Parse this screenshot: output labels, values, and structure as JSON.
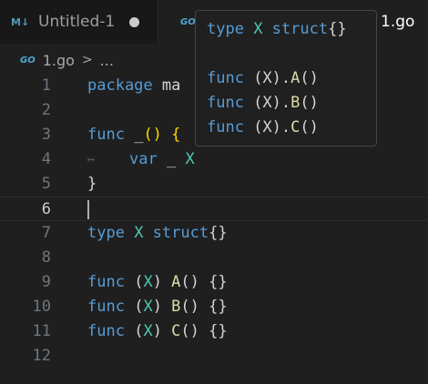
{
  "tabs": [
    {
      "label": "Untitled-1",
      "icon": "markdown-icon",
      "icon_text": "M↓",
      "dirty": true
    },
    {
      "label": "1.go",
      "icon": "go-icon",
      "icon_text": "GO",
      "active": true
    }
  ],
  "breadcrumb": {
    "icon_text": "GO",
    "file": "1.go",
    "separator": ">",
    "more": "..."
  },
  "editor": {
    "lines": [
      {
        "n": "1",
        "t": [
          "package",
          " ma"
        ]
      },
      {
        "n": "2"
      },
      {
        "n": "3",
        "t": [
          "func",
          " _",
          "()",
          " {"
        ]
      },
      {
        "n": "4",
        "t": [
          "var",
          " _ ",
          "X"
        ],
        "indent_marker": "↦"
      },
      {
        "n": "5",
        "t": [
          "}"
        ]
      },
      {
        "n": "6",
        "current": true
      },
      {
        "n": "7",
        "t": [
          "type",
          " X",
          " struct",
          "{}"
        ]
      },
      {
        "n": "8"
      },
      {
        "n": "9",
        "t": [
          "func",
          " (",
          "X",
          ") ",
          "A",
          "()",
          " {}"
        ]
      },
      {
        "n": "10",
        "t": [
          "func",
          " (",
          "X",
          ") ",
          "B",
          "()",
          " {}"
        ]
      },
      {
        "n": "11",
        "t": [
          "func",
          " (",
          "X",
          ") ",
          "C",
          "()",
          " {}"
        ]
      },
      {
        "n": "12"
      }
    ]
  },
  "hover": {
    "lines": [
      [
        "type",
        " X",
        " struct",
        "{}"
      ],
      [],
      [
        "func",
        " (X).",
        "A",
        "()"
      ],
      [
        "func",
        " (X).",
        "B",
        "()"
      ],
      [
        "func",
        " (X).",
        "C",
        "()"
      ]
    ]
  },
  "colors": {
    "keyword": "#569cd6",
    "type": "#4ec9b0",
    "function": "#dcdcaa",
    "bracket": "#ffd700"
  }
}
